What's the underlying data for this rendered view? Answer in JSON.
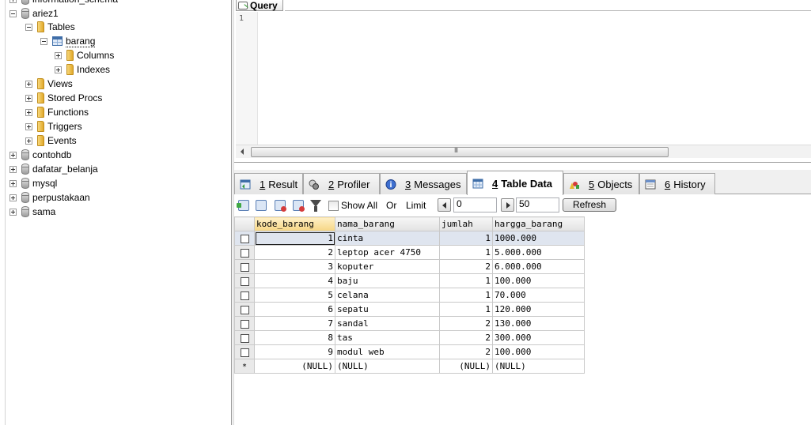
{
  "tree": {
    "items": [
      {
        "label": "information_schema",
        "kind": "database",
        "expander": "plus"
      },
      {
        "label": "ariez1",
        "kind": "database",
        "expander": "minus"
      },
      {
        "label": "Tables",
        "kind": "folder",
        "expander": "minus"
      },
      {
        "label": "barang",
        "kind": "table",
        "expander": "minus",
        "selected": true
      },
      {
        "label": "Columns",
        "kind": "folder",
        "expander": "plus"
      },
      {
        "label": "Indexes",
        "kind": "folder",
        "expander": "plus"
      },
      {
        "label": "Views",
        "kind": "folder",
        "expander": "plus"
      },
      {
        "label": "Stored Procs",
        "kind": "folder",
        "expander": "plus"
      },
      {
        "label": "Functions",
        "kind": "folder",
        "expander": "plus"
      },
      {
        "label": "Triggers",
        "kind": "folder",
        "expander": "plus"
      },
      {
        "label": "Events",
        "kind": "folder",
        "expander": "plus"
      },
      {
        "label": "contohdb",
        "kind": "database",
        "expander": "plus"
      },
      {
        "label": "dafatar_belanja",
        "kind": "database",
        "expander": "plus"
      },
      {
        "label": "mysql",
        "kind": "database",
        "expander": "plus"
      },
      {
        "label": "perpustakaan",
        "kind": "database",
        "expander": "plus"
      },
      {
        "label": "sama",
        "kind": "database",
        "expander": "plus"
      }
    ]
  },
  "editor": {
    "tab_label": "Query",
    "line_number": "1"
  },
  "results": {
    "tabs": [
      {
        "num": "1",
        "label": "Result",
        "icon": "result-grid-icon"
      },
      {
        "num": "2",
        "label": "Profiler",
        "icon": "profiler-icon"
      },
      {
        "num": "3",
        "label": "Messages",
        "icon": "messages-icon"
      },
      {
        "num": "4",
        "label": "Table Data",
        "icon": "table-data-icon",
        "active": true
      },
      {
        "num": "5",
        "label": "Objects",
        "icon": "objects-icon"
      },
      {
        "num": "6",
        "label": "History",
        "icon": "history-icon"
      }
    ],
    "toolbar": {
      "show_all_label": "Show All",
      "or_label": "Or",
      "limit_label": "Limit",
      "offset_value": "0",
      "count_value": "50",
      "refresh_label": "Refresh"
    },
    "grid": {
      "columns": [
        "kode_barang",
        "nama_barang",
        "jumlah",
        "hargga_barang"
      ],
      "rows": [
        [
          "1",
          "cinta",
          "1",
          "1000.000"
        ],
        [
          "2",
          "leptop acer 4750",
          "1",
          "5.000.000"
        ],
        [
          "3",
          "koputer",
          "2",
          "6.000.000"
        ],
        [
          "4",
          "baju",
          "1",
          "100.000"
        ],
        [
          "5",
          "celana",
          "1",
          "70.000"
        ],
        [
          "6",
          "sepatu",
          "1",
          "120.000"
        ],
        [
          "7",
          "sandal",
          "2",
          "130.000"
        ],
        [
          "8",
          "tas",
          "2",
          "300.000"
        ],
        [
          "9",
          "modul web",
          "2",
          "100.000"
        ]
      ],
      "new_row": {
        "marker": "*",
        "values": [
          "(NULL)",
          "(NULL)",
          "(NULL)",
          "(NULL)"
        ]
      }
    }
  },
  "colors": {
    "sorted_header": "#f6d684",
    "selected_row": "#dfe5ef"
  }
}
